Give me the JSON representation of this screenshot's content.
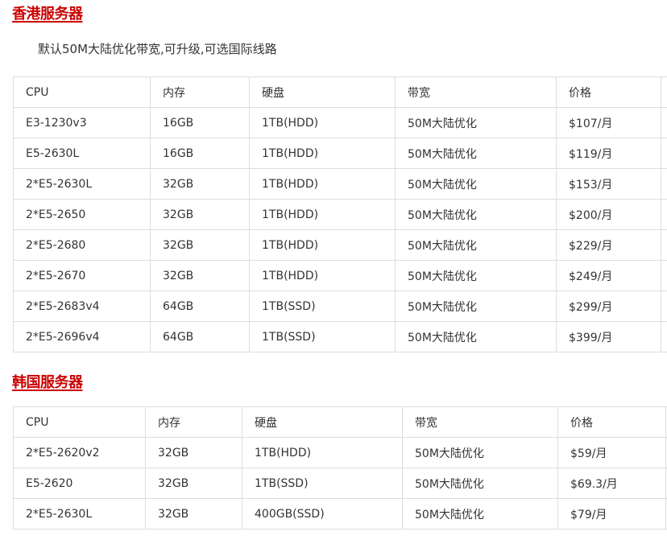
{
  "hk": {
    "title": "香港服务器",
    "note": "默认50M大陆优化带宽,可升级,可选国际线路",
    "headers": [
      "CPU",
      "内存",
      "硬盘",
      "带宽",
      "价格"
    ],
    "rows": [
      [
        "E3-1230v3",
        "16GB",
        "1TB(HDD)",
        "50M大陆优化",
        "$107/月"
      ],
      [
        "E5-2630L",
        "16GB",
        "1TB(HDD)",
        "50M大陆优化",
        "$119/月"
      ],
      [
        "2*E5-2630L",
        "32GB",
        "1TB(HDD)",
        "50M大陆优化",
        "$153/月"
      ],
      [
        "2*E5-2650",
        "32GB",
        "1TB(HDD)",
        "50M大陆优化",
        "$200/月"
      ],
      [
        "2*E5-2680",
        "32GB",
        "1TB(HDD)",
        "50M大陆优化",
        "$229/月"
      ],
      [
        "2*E5-2670",
        "32GB",
        "1TB(HDD)",
        "50M大陆优化",
        "$249/月"
      ],
      [
        "2*E5-2683v4",
        "64GB",
        "1TB(SSD)",
        "50M大陆优化",
        "$299/月"
      ],
      [
        "2*E5-2696v4",
        "64GB",
        "1TB(SSD)",
        "50M大陆优化",
        "$399/月"
      ]
    ]
  },
  "kr": {
    "title": "韩国服务器",
    "headers": [
      "CPU",
      "内存",
      "硬盘",
      "带宽",
      "价格"
    ],
    "rows": [
      [
        "2*E5-2620v2",
        "32GB",
        "1TB(HDD)",
        "50M大陆优化",
        "$59/月"
      ],
      [
        "E5-2620",
        "32GB",
        "1TB(SSD)",
        "50M大陆优化",
        "$69.3/月"
      ],
      [
        "2*E5-2630L",
        "32GB",
        "400GB(SSD)",
        "50M大陆优化",
        "$79/月"
      ]
    ]
  },
  "colors": {
    "heading": "#cc0000",
    "text": "#333333",
    "border": "#dddddd"
  }
}
